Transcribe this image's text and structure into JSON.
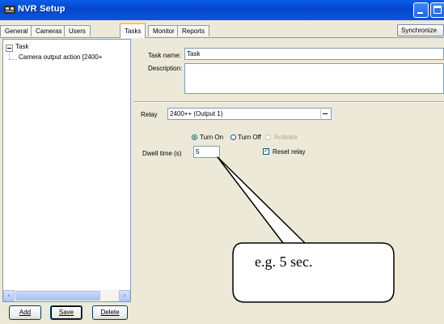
{
  "window": {
    "title": "NVR Setup"
  },
  "icons": {
    "app": "nvr-app-icon",
    "minimize": "minimize-icon",
    "maximize": "maximize-icon",
    "close": "close-icon"
  },
  "tabs": [
    {
      "label": "General"
    },
    {
      "label": "Cameras"
    },
    {
      "label": "Users"
    },
    {
      "label": "Tasks"
    },
    {
      "label": "Monitor"
    },
    {
      "label": "Reports"
    }
  ],
  "active_tab": "Tasks",
  "synchronize_label": "Synchronize",
  "tree": {
    "root": "Task",
    "child": "Camera output action [2400+"
  },
  "buttons": {
    "add": "Add",
    "save": "Save",
    "delete": "Delete"
  },
  "task_form": {
    "task_name_label": "Task name:",
    "task_name_value": "Task",
    "description_label": "Description:",
    "description_value": ""
  },
  "relay": {
    "label": "Relay",
    "selected": "2400++ (Output 1)",
    "options": {
      "turn_on": "Turn On",
      "turn_off": "Turn Off",
      "activate": "Activate"
    },
    "selected_option": "Turn On",
    "dwell_label": "Dwell time (s)",
    "dwell_value": "5",
    "reset_label": "Reset relay",
    "reset_checked": true
  },
  "callout": {
    "text": "e.g. 5 sec."
  },
  "colors": {
    "titlebar": "#0a56dd",
    "window_bg": "#ece9d8",
    "active_tab_highlight": "#ffc83c"
  }
}
